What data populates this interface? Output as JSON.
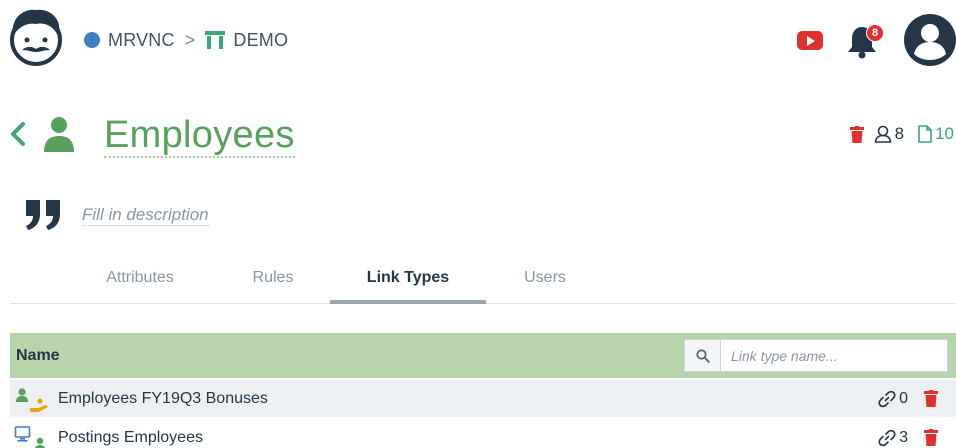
{
  "breadcrumb": {
    "organization": "MRVNC",
    "separator": ">",
    "project": "DEMO"
  },
  "notifications": {
    "count": "8"
  },
  "collection": {
    "name": "Employees",
    "members_count": "8",
    "documents_count": "10",
    "description_placeholder": "Fill in description"
  },
  "tabs": [
    {
      "label": "Attributes",
      "active": false
    },
    {
      "label": "Rules",
      "active": false
    },
    {
      "label": "Link Types",
      "active": true
    },
    {
      "label": "Users",
      "active": false
    }
  ],
  "table": {
    "header_name": "Name",
    "search_placeholder": "Link type name...",
    "rows": [
      {
        "name": "Employees FY19Q3 Bonuses",
        "links_count": "0",
        "icons": [
          "user-icon",
          "hand-coin-icon"
        ]
      },
      {
        "name": "Postings Employees",
        "links_count": "3",
        "icons": [
          "monitor-icon",
          "user-icon"
        ]
      }
    ]
  },
  "colors": {
    "accent_green": "#57a05d",
    "header_green": "#b7d4aa",
    "danger_red": "#e03131",
    "docs_teal": "#3aa870",
    "org_blue": "#3b7fc4"
  }
}
